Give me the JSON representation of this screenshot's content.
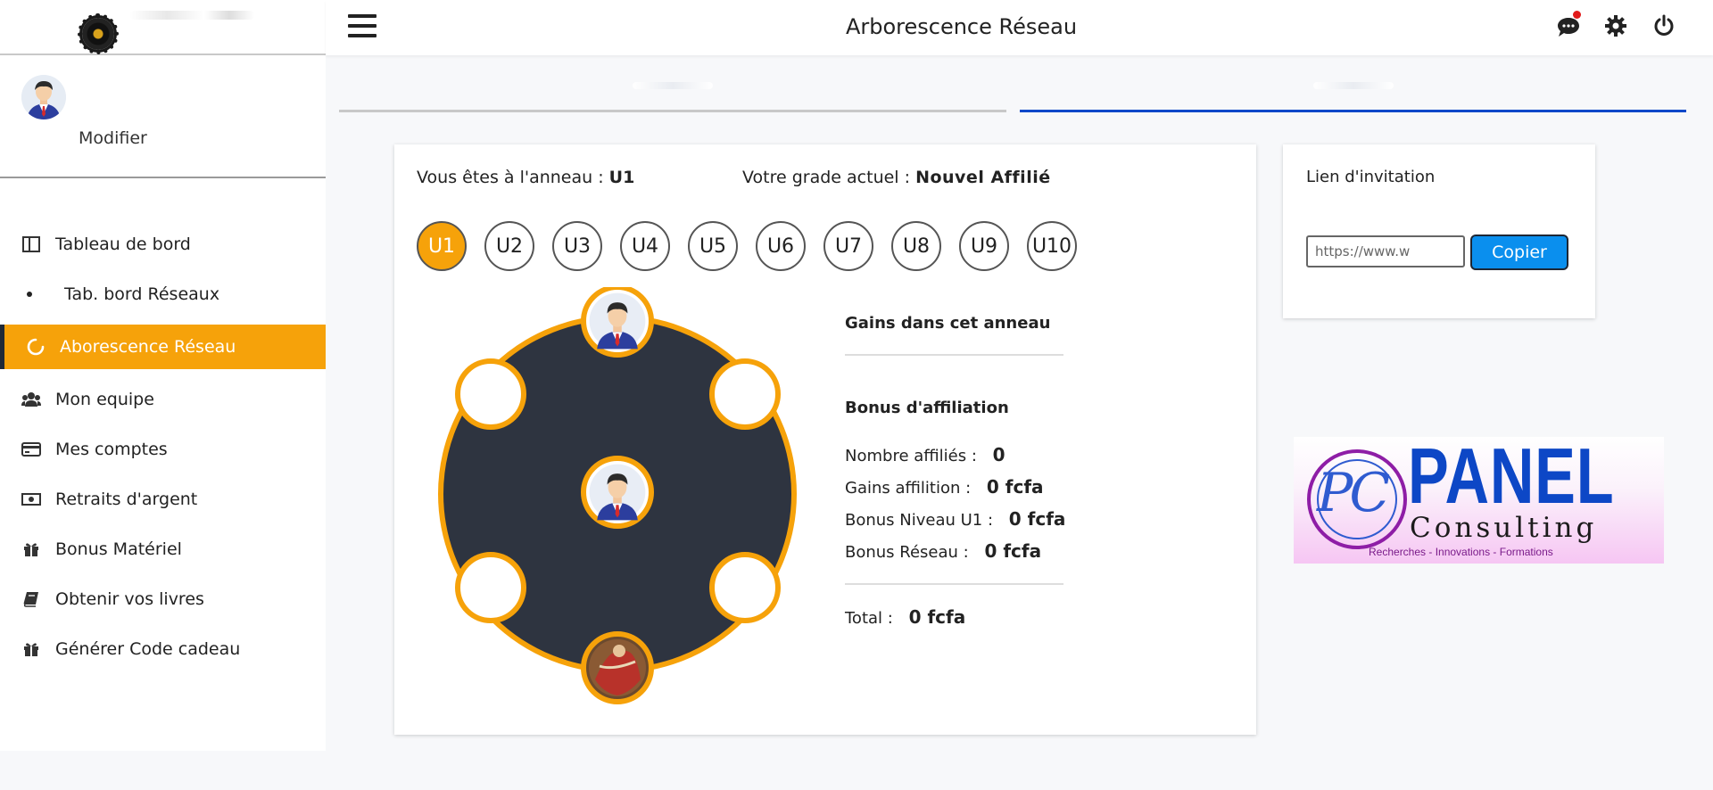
{
  "page": {
    "title": "Arborescence Réseau"
  },
  "sidebar": {
    "profile": {
      "edit_label": "Modifier"
    },
    "items": [
      {
        "label": "Tableau de bord",
        "icon": "columns-icon"
      },
      {
        "label": "Tab. bord Réseaux",
        "icon": "bullet-icon"
      },
      {
        "label": "Aborescence Réseau",
        "icon": "circle-notch-icon",
        "active": true
      },
      {
        "label": "Mon equipe",
        "icon": "users-icon"
      },
      {
        "label": "Mes comptes",
        "icon": "credit-card-icon"
      },
      {
        "label": "Retraits d'argent",
        "icon": "money-bill-icon"
      },
      {
        "label": "Bonus Matériel",
        "icon": "gift-icon"
      },
      {
        "label": "Obtenir vos livres",
        "icon": "book-icon"
      },
      {
        "label": "Générer Code cadeau",
        "icon": "gift-icon"
      }
    ]
  },
  "topbar": {
    "icons": [
      "menu-icon",
      "chat-icon",
      "gear-icon",
      "power-icon"
    ]
  },
  "colors": {
    "accent": "#f6a20a",
    "tab_active": "#0b48c9",
    "button": "#0a8fee",
    "ring_fill": "#2e3440"
  },
  "ring": {
    "ring_label": "Vous êtes à l'anneau :",
    "ring_value": "U1",
    "grade_label": "Votre grade actuel :",
    "grade_value": "Nouvel Affilié",
    "levels": [
      "U1",
      "U2",
      "U3",
      "U4",
      "U5",
      "U6",
      "U7",
      "U8",
      "U9",
      "U10"
    ],
    "active_level": "U1"
  },
  "gains": {
    "title": "Gains dans cet anneau",
    "bonus_title": "Bonus d'affiliation",
    "rows": [
      {
        "label": "Nombre affiliés :",
        "value": "0"
      },
      {
        "label": "Gains affilition :",
        "value": "0 fcfa"
      },
      {
        "label": "Bonus Niveau U1 :",
        "value": "0 fcfa"
      },
      {
        "label": "Bonus Réseau :",
        "value": "0 fcfa"
      }
    ],
    "total_label": "Total :",
    "total_value": "0 fcfa"
  },
  "invite": {
    "title": "Lien d'invitation",
    "url": "https://www.w",
    "copy_label": "Copier"
  },
  "banner": {
    "pc": "PC",
    "panel": "PANEL",
    "consulting": "Consulting",
    "tagline": "Recherches  -  Innovations  -  Formations"
  }
}
